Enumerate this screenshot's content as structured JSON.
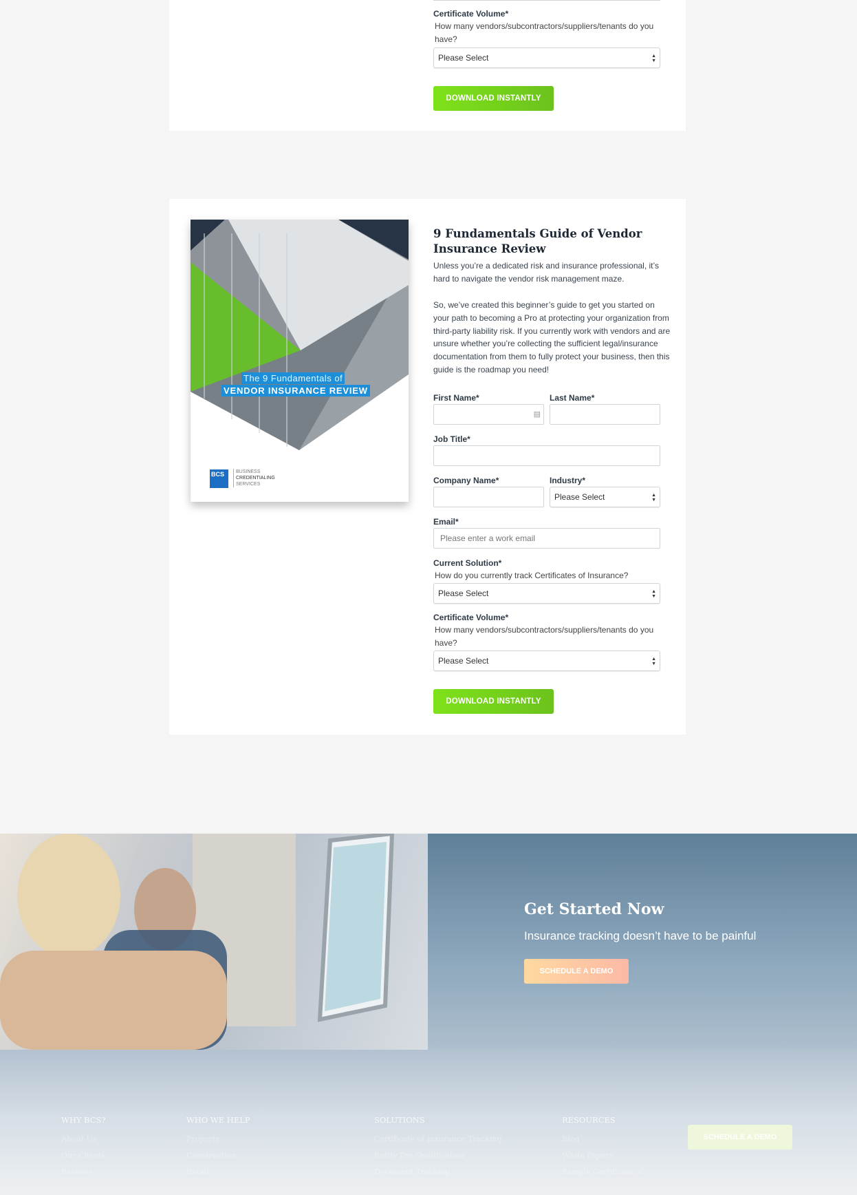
{
  "top_form": {
    "certificate_volume_label": "Certificate Volume*",
    "certificate_volume_help": "How many vendors/subcontractors/suppliers/tenants do you have?",
    "certificate_volume_value": "Please Select",
    "submit_label": "DOWNLOAD INSTANTLY"
  },
  "guide": {
    "title": "9 Fundamentals Guide of Vendor Insurance Review",
    "paragraph1": "Unless you’re a dedicated risk and insurance professional, it’s hard to navigate the vendor risk management maze.",
    "paragraph2": "So, we’ve created this beginner’s guide to get you started on your path to becoming a Pro at protecting your organization from third-party liability risk. If you currently work with vendors and are unsure whether you’re collecting the sufficient legal/insurance documentation from them to fully protect your business, then this guide is the roadmap you need!",
    "cover": {
      "line1": "The 9 Fundamentals of",
      "line2": "VENDOR INSURANCE REVIEW",
      "logo_text": "BCS",
      "logo_sub": [
        "BUSINESS",
        "CREDENTIALING",
        "SERVICES"
      ]
    },
    "form": {
      "first_name_label": "First Name*",
      "last_name_label": "Last Name*",
      "job_title_label": "Job Title*",
      "company_label": "Company Name*",
      "industry_label": "Industry*",
      "industry_value": "Please Select",
      "email_label": "Email*",
      "email_placeholder": "Please enter a work email",
      "current_solution_label": "Current Solution*",
      "current_solution_help": "How do you currently track Certificates of Insurance?",
      "current_solution_value": "Please Select",
      "certificate_volume_label": "Certificate Volume*",
      "certificate_volume_help": "How many vendors/subcontractors/suppliers/tenants do you have?",
      "certificate_volume_value": "Please Select",
      "submit_label": "DOWNLOAD INSTANTLY"
    }
  },
  "cta": {
    "title": "Get Started Now",
    "subtitle": "Insurance tracking doesn’t have to be painful",
    "button": "SCHEDULE A DEMO"
  },
  "footer": {
    "columns": [
      {
        "heading": "WHY BCS?",
        "links": [
          "About Us",
          "Our Clients",
          "Reviews"
        ]
      },
      {
        "heading": "WHO WE HELP",
        "links": [
          "Property",
          "Construction",
          "Retail"
        ]
      },
      {
        "heading": "SOLUTIONS",
        "links": [
          "Certificate of Insurance Tracking",
          "Entity Pre-Qualification",
          "Document Tracking"
        ]
      },
      {
        "heading": "RESOURCES",
        "links": [
          "Blog",
          "White Papers",
          "Sample Certificate of"
        ]
      }
    ],
    "button": "SCHEDULE A DEMO"
  },
  "colors": {
    "accent_green": "#7ee21a",
    "cta_orange": "#fbc9a0",
    "cover_blue": "#1c8fd8"
  }
}
